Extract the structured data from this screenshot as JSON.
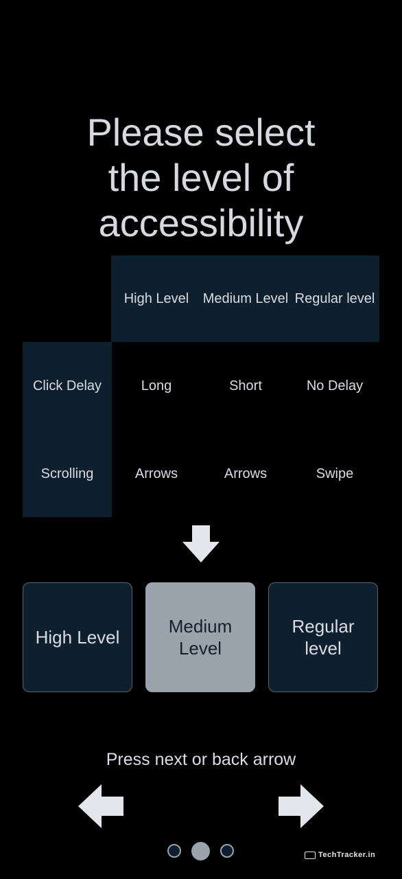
{
  "title": {
    "lines": [
      "Please select",
      "the level of",
      "accessibility"
    ]
  },
  "table": {
    "headers": [
      "High Level",
      "Medium Level",
      "Regular level"
    ],
    "rows": [
      {
        "label": "Click Delay",
        "values": [
          "Long",
          "Short",
          "No Delay"
        ]
      },
      {
        "label": "Scrolling",
        "values": [
          "Arrows",
          "Arrows",
          "Swipe"
        ]
      }
    ]
  },
  "options": [
    {
      "label": "High Level",
      "selected": false
    },
    {
      "label": "Medium Level",
      "selected": true
    },
    {
      "label": "Regular level",
      "selected": false
    }
  ],
  "hint": "Press next or back arrow",
  "pagination": {
    "current": 2,
    "total": 3
  },
  "watermark": "TechTracker.in",
  "icons": {
    "down": "arrow-down-icon",
    "back": "arrow-left-icon",
    "next": "arrow-right-icon"
  },
  "colors": {
    "background": "#000000",
    "panel": "#0e1f2e",
    "selected": "#9aa3ac",
    "text": "#d9dde3"
  }
}
